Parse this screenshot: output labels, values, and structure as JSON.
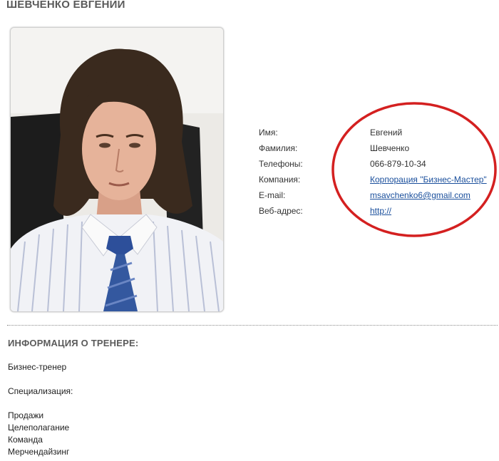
{
  "title": "ШЕВЧЕНКО ЕВГЕНИЙ",
  "contact": {
    "rows": [
      {
        "label": "Имя:",
        "value": "Евгений"
      },
      {
        "label": "Фамилия:",
        "value": "Шевченко"
      },
      {
        "label": "Телефоны:",
        "value": "066-879-10-34"
      },
      {
        "label": "Компания:",
        "value": "Корпорация \"Бизнес-Мастер\""
      },
      {
        "label": "E-mail:",
        "value": "msavchenko6@gmail.com"
      },
      {
        "label": "Веб-адрес:",
        "value": "http://"
      }
    ]
  },
  "trainer_info": {
    "title": "ИНФОРМАЦИЯ О ТРЕНЕРЕ:",
    "role": "Бизнес-тренер",
    "specialization_label": "Специализация:",
    "specializations": [
      "Продажи",
      "Целеполагание",
      "Команда",
      "Мерчендайзинг"
    ]
  },
  "colors": {
    "heading": "#5a5a5a",
    "link": "#1a4f9c",
    "highlight": "#d42020"
  }
}
